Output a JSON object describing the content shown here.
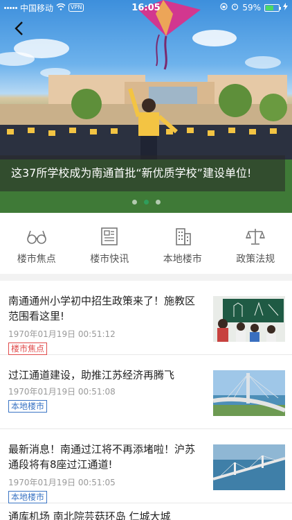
{
  "status": {
    "carrier": "中国移动",
    "vpn": "VPN",
    "time": "16:05",
    "battery": "59%",
    "battery_level": 0.59
  },
  "banner": {
    "caption": "这37所学校成为南通首批“新优质学校”建设单位!",
    "slide_count": 3,
    "active_slide": 2
  },
  "categories": [
    {
      "label": "楼市焦点",
      "icon": "glasses-icon"
    },
    {
      "label": "楼市快讯",
      "icon": "newsletter-icon"
    },
    {
      "label": "本地楼市",
      "icon": "building-icon"
    },
    {
      "label": "政策法规",
      "icon": "scales-icon"
    }
  ],
  "news": [
    {
      "title": "南通通州小学初中招生政策来了！施教区范围看这里!",
      "time": "1970年01月19日 00:51:12",
      "tag": "楼市焦点",
      "tag_color": "#e04a4a",
      "thumb": "classroom-photo"
    },
    {
      "title": "过江通道建设，助推江苏经济再腾飞",
      "time": "1970年01月19日 00:51:08",
      "tag": "本地楼市",
      "tag_color": "#3a74c4",
      "thumb": "bridge-photo"
    },
    {
      "title": "最新消息！南通过江将不再添堵啦！沪苏通段将有8座过江通道!",
      "time": "1970年01月19日 00:51:05",
      "tag": "本地楼市",
      "tag_color": "#3a74c4",
      "thumb": "bridge-aerial-photo"
    }
  ],
  "partial_title": "通库机场   南北院芸菇环岛 仁城大城"
}
